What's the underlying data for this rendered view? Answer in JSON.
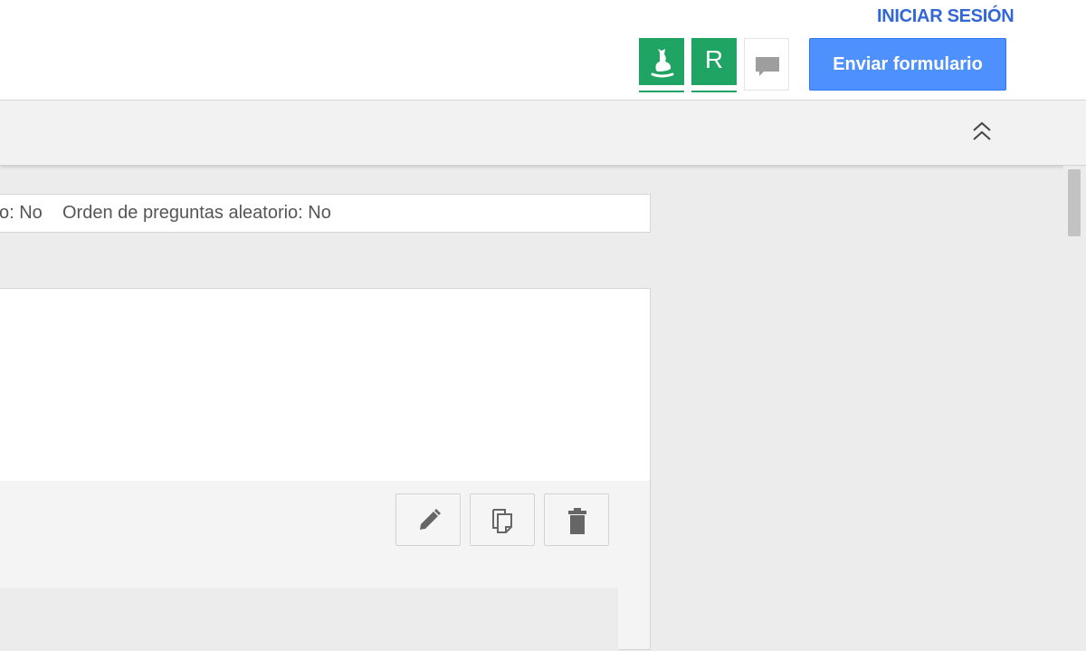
{
  "header": {
    "signin_label": "INICIAR SESIÓN",
    "send_button_label": "Enviar formulario",
    "addons": [
      {
        "icon": "animal-logo-icon",
        "color": "#1fa463"
      },
      {
        "letter": "R",
        "color": "#1fa463"
      }
    ],
    "chat_icon": "chat-bubble-icon"
  },
  "subbar": {
    "collapse_icon": "double-chevron-up-icon"
  },
  "settings": {
    "partial_value": "o: No",
    "random_order_label": "Orden de preguntas aleatorio: No"
  },
  "question_card": {
    "tools": [
      "pencil-icon",
      "copy-icon",
      "trash-icon"
    ]
  },
  "colors": {
    "accent_blue": "#4d90fe",
    "link_blue": "#3367d6",
    "addon_green": "#1fa463"
  }
}
